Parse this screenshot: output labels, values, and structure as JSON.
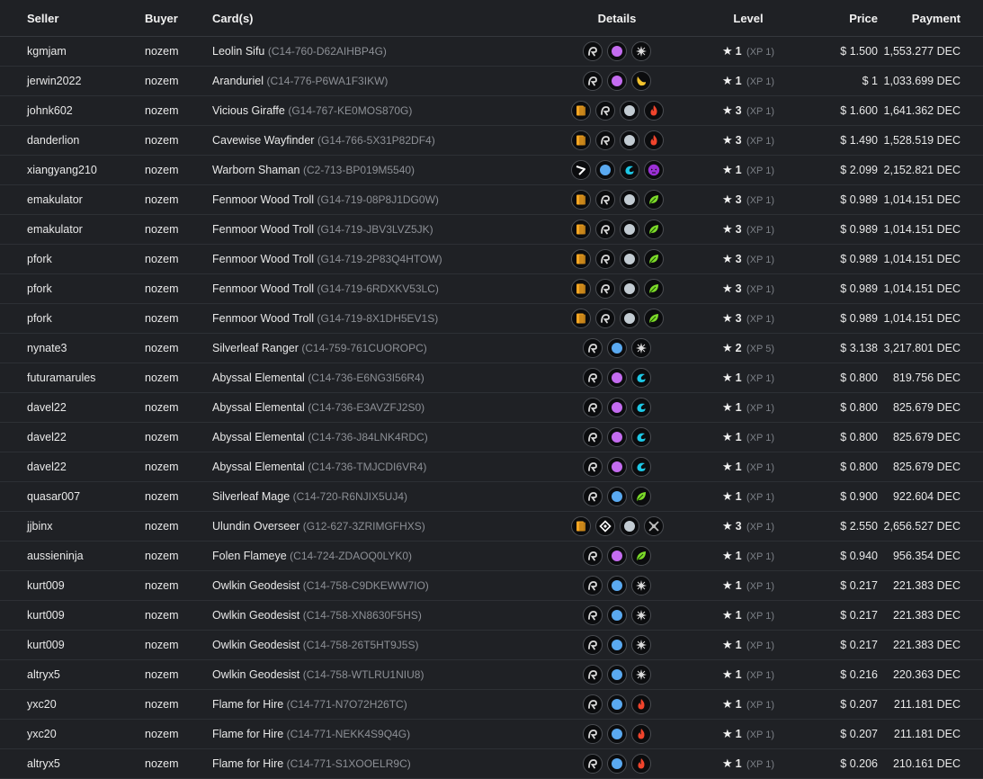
{
  "headers": {
    "seller": "Seller",
    "buyer": "Buyer",
    "cards": "Card(s)",
    "details": "Details",
    "level": "Level",
    "price": "Price",
    "payment": "Payment"
  },
  "colors": {
    "gold": "#f5a623",
    "edition_white": "#d9d9d9",
    "water": "#1ec8e6",
    "fire": "#f0442c",
    "earth": "#7ddb2a",
    "death": "#9b30d6",
    "life": "#f3c32d",
    "neutral": "#ddd",
    "rarity_epic": "#c46cf0",
    "rarity_rare": "#5aa9f0",
    "rarity_common": "#c3ccd3",
    "rarity_legendary": "#ffffff"
  },
  "rows": [
    {
      "seller": "kgmjam",
      "buyer": "nozem",
      "card": "Leolin Sifu",
      "uid": "(C14-760-D62AIHBP4G)",
      "icons": [
        "edition-icon",
        "epic-rarity-icon",
        "neutral-element-icon"
      ],
      "level": "1",
      "xp": "(XP 1)",
      "price": "$ 1.500",
      "payment": "1,553.277 DEC"
    },
    {
      "seller": "jerwin2022",
      "buyer": "nozem",
      "card": "Aranduriel",
      "uid": "(C14-776-P6WA1F3IKW)",
      "icons": [
        "edition-icon",
        "epic-rarity-icon",
        "life-element-icon"
      ],
      "level": "1",
      "xp": "(XP 1)",
      "price": "$ 1",
      "payment": "1,033.699 DEC"
    },
    {
      "seller": "johnk602",
      "buyer": "nozem",
      "card": "Vicious Giraffe",
      "uid": "(G14-767-KE0MOS870G)",
      "icons": [
        "gold-foil-icon",
        "edition-icon",
        "common-rarity-icon",
        "fire-element-icon"
      ],
      "level": "3",
      "xp": "(XP 1)",
      "price": "$ 1.600",
      "payment": "1,641.362 DEC"
    },
    {
      "seller": "danderlion",
      "buyer": "nozem",
      "card": "Cavewise Wayfinder",
      "uid": "(G14-766-5X31P82DF4)",
      "icons": [
        "gold-foil-icon",
        "edition-icon",
        "common-rarity-icon",
        "fire-element-icon"
      ],
      "level": "3",
      "xp": "(XP 1)",
      "price": "$ 1.490",
      "payment": "1,528.519 DEC"
    },
    {
      "seller": "xiangyang210",
      "buyer": "nozem",
      "card": "Warborn Shaman",
      "uid": "(C2-713-BP019M5540)",
      "icons": [
        "chaos-edition-icon",
        "rare-rarity-icon",
        "water-element-icon",
        "death-element-icon"
      ],
      "level": "1",
      "xp": "(XP 1)",
      "price": "$ 2.099",
      "payment": "2,152.821 DEC"
    },
    {
      "seller": "emakulator",
      "buyer": "nozem",
      "card": "Fenmoor Wood Troll",
      "uid": "(G14-719-08P8J1DG0W)",
      "icons": [
        "gold-foil-icon",
        "edition-icon",
        "common-rarity-icon",
        "earth-element-icon"
      ],
      "level": "3",
      "xp": "(XP 1)",
      "price": "$ 0.989",
      "payment": "1,014.151 DEC"
    },
    {
      "seller": "emakulator",
      "buyer": "nozem",
      "card": "Fenmoor Wood Troll",
      "uid": "(G14-719-JBV3LVZ5JK)",
      "icons": [
        "gold-foil-icon",
        "edition-icon",
        "common-rarity-icon",
        "earth-element-icon"
      ],
      "level": "3",
      "xp": "(XP 1)",
      "price": "$ 0.989",
      "payment": "1,014.151 DEC"
    },
    {
      "seller": "pfork",
      "buyer": "nozem",
      "card": "Fenmoor Wood Troll",
      "uid": "(G14-719-2P83Q4HTOW)",
      "icons": [
        "gold-foil-icon",
        "edition-icon",
        "common-rarity-icon",
        "earth-element-icon"
      ],
      "level": "3",
      "xp": "(XP 1)",
      "price": "$ 0.989",
      "payment": "1,014.151 DEC"
    },
    {
      "seller": "pfork",
      "buyer": "nozem",
      "card": "Fenmoor Wood Troll",
      "uid": "(G14-719-6RDXKV53LC)",
      "icons": [
        "gold-foil-icon",
        "edition-icon",
        "common-rarity-icon",
        "earth-element-icon"
      ],
      "level": "3",
      "xp": "(XP 1)",
      "price": "$ 0.989",
      "payment": "1,014.151 DEC"
    },
    {
      "seller": "pfork",
      "buyer": "nozem",
      "card": "Fenmoor Wood Troll",
      "uid": "(G14-719-8X1DH5EV1S)",
      "icons": [
        "gold-foil-icon",
        "edition-icon",
        "common-rarity-icon",
        "earth-element-icon"
      ],
      "level": "3",
      "xp": "(XP 1)",
      "price": "$ 0.989",
      "payment": "1,014.151 DEC"
    },
    {
      "seller": "nynate3",
      "buyer": "nozem",
      "card": "Silverleaf Ranger",
      "uid": "(C14-759-761CUOROPC)",
      "icons": [
        "edition-icon",
        "rare-rarity-icon",
        "neutral-element-icon"
      ],
      "level": "2",
      "xp": "(XP 5)",
      "price": "$ 3.138",
      "payment": "3,217.801 DEC"
    },
    {
      "seller": "futuramarules",
      "buyer": "nozem",
      "card": "Abyssal Elemental",
      "uid": "(C14-736-E6NG3I56R4)",
      "icons": [
        "edition-icon",
        "epic-rarity-icon",
        "water-element-icon"
      ],
      "level": "1",
      "xp": "(XP 1)",
      "price": "$ 0.800",
      "payment": "819.756 DEC"
    },
    {
      "seller": "davel22",
      "buyer": "nozem",
      "card": "Abyssal Elemental",
      "uid": "(C14-736-E3AVZFJ2S0)",
      "icons": [
        "edition-icon",
        "epic-rarity-icon",
        "water-element-icon"
      ],
      "level": "1",
      "xp": "(XP 1)",
      "price": "$ 0.800",
      "payment": "825.679 DEC"
    },
    {
      "seller": "davel22",
      "buyer": "nozem",
      "card": "Abyssal Elemental",
      "uid": "(C14-736-J84LNK4RDC)",
      "icons": [
        "edition-icon",
        "epic-rarity-icon",
        "water-element-icon"
      ],
      "level": "1",
      "xp": "(XP 1)",
      "price": "$ 0.800",
      "payment": "825.679 DEC"
    },
    {
      "seller": "davel22",
      "buyer": "nozem",
      "card": "Abyssal Elemental",
      "uid": "(C14-736-TMJCDI6VR4)",
      "icons": [
        "edition-icon",
        "epic-rarity-icon",
        "water-element-icon"
      ],
      "level": "1",
      "xp": "(XP 1)",
      "price": "$ 0.800",
      "payment": "825.679 DEC"
    },
    {
      "seller": "quasar007",
      "buyer": "nozem",
      "card": "Silverleaf Mage",
      "uid": "(C14-720-R6NJIX5UJ4)",
      "icons": [
        "edition-icon",
        "rare-rarity-icon",
        "earth-element-icon"
      ],
      "level": "1",
      "xp": "(XP 1)",
      "price": "$ 0.900",
      "payment": "922.604 DEC"
    },
    {
      "seller": "jjbinx",
      "buyer": "nozem",
      "card": "Ulundin Overseer",
      "uid": "(G12-627-3ZRIMGFHXS)",
      "icons": [
        "gold-foil-icon",
        "rebellion-edition-icon",
        "common-rarity-icon",
        "dragon-element-icon"
      ],
      "level": "3",
      "xp": "(XP 1)",
      "price": "$ 2.550",
      "payment": "2,656.527 DEC"
    },
    {
      "seller": "aussieninja",
      "buyer": "nozem",
      "card": "Folen Flameye",
      "uid": "(C14-724-ZDAOQ0LYK0)",
      "icons": [
        "edition-icon",
        "epic-rarity-icon",
        "earth-element-icon"
      ],
      "level": "1",
      "xp": "(XP 1)",
      "price": "$ 0.940",
      "payment": "956.354 DEC"
    },
    {
      "seller": "kurt009",
      "buyer": "nozem",
      "card": "Owlkin Geodesist",
      "uid": "(C14-758-C9DKEWW7IO)",
      "icons": [
        "edition-icon",
        "rare-rarity-icon",
        "neutral-element-icon"
      ],
      "level": "1",
      "xp": "(XP 1)",
      "price": "$ 0.217",
      "payment": "221.383 DEC"
    },
    {
      "seller": "kurt009",
      "buyer": "nozem",
      "card": "Owlkin Geodesist",
      "uid": "(C14-758-XN8630F5HS)",
      "icons": [
        "edition-icon",
        "rare-rarity-icon",
        "neutral-element-icon"
      ],
      "level": "1",
      "xp": "(XP 1)",
      "price": "$ 0.217",
      "payment": "221.383 DEC"
    },
    {
      "seller": "kurt009",
      "buyer": "nozem",
      "card": "Owlkin Geodesist",
      "uid": "(C14-758-26T5HT9J5S)",
      "icons": [
        "edition-icon",
        "rare-rarity-icon",
        "neutral-element-icon"
      ],
      "level": "1",
      "xp": "(XP 1)",
      "price": "$ 0.217",
      "payment": "221.383 DEC"
    },
    {
      "seller": "altryx5",
      "buyer": "nozem",
      "card": "Owlkin Geodesist",
      "uid": "(C14-758-WTLRU1NIU8)",
      "icons": [
        "edition-icon",
        "rare-rarity-icon",
        "neutral-element-icon"
      ],
      "level": "1",
      "xp": "(XP 1)",
      "price": "$ 0.216",
      "payment": "220.363 DEC"
    },
    {
      "seller": "yxc20",
      "buyer": "nozem",
      "card": "Flame for Hire",
      "uid": "(C14-771-N7O72H26TC)",
      "icons": [
        "edition-icon",
        "rare-rarity-icon",
        "fire-element-icon"
      ],
      "level": "1",
      "xp": "(XP 1)",
      "price": "$ 0.207",
      "payment": "211.181 DEC"
    },
    {
      "seller": "yxc20",
      "buyer": "nozem",
      "card": "Flame for Hire",
      "uid": "(C14-771-NEKK4S9Q4G)",
      "icons": [
        "edition-icon",
        "rare-rarity-icon",
        "fire-element-icon"
      ],
      "level": "1",
      "xp": "(XP 1)",
      "price": "$ 0.207",
      "payment": "211.181 DEC"
    },
    {
      "seller": "altryx5",
      "buyer": "nozem",
      "card": "Flame for Hire",
      "uid": "(C14-771-S1XOOELR9C)",
      "icons": [
        "edition-icon",
        "rare-rarity-icon",
        "fire-element-icon"
      ],
      "level": "1",
      "xp": "(XP 1)",
      "price": "$ 0.206",
      "payment": "210.161 DEC"
    }
  ]
}
